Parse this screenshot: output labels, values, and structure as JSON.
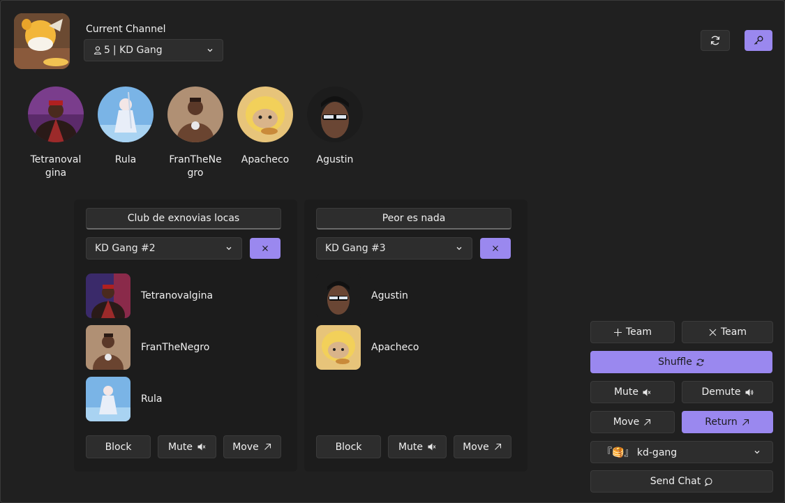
{
  "header": {
    "channel_label": "Current Channel",
    "channel_count": "5",
    "channel_name": "| KD Gang"
  },
  "members": [
    {
      "name": "Tetranovalgina"
    },
    {
      "name": "Rula"
    },
    {
      "name": "FranTheNegro"
    },
    {
      "name": "Apacheco"
    },
    {
      "name": "Agustin"
    }
  ],
  "teams": [
    {
      "name": "Club de exnovias locas",
      "channel": "KD Gang #2",
      "players": [
        "Tetranovalgina",
        "FranTheNegro",
        "Rula"
      ],
      "block_label": "Block",
      "mute_label": "Mute",
      "move_label": "Move"
    },
    {
      "name": "Peor es nada",
      "channel": "KD Gang #3",
      "players": [
        "Agustin",
        "Apacheco"
      ],
      "block_label": "Block",
      "mute_label": "Mute",
      "move_label": "Move"
    }
  ],
  "controls": {
    "add_team": "Team",
    "remove_team": "Team",
    "shuffle": "Shuffle",
    "mute": "Mute",
    "demute": "Demute",
    "move": "Move",
    "return": "Return",
    "text_channel": "『🥞』 kd-gang",
    "send_chat": "Send Chat"
  },
  "colors": {
    "background": "#202020",
    "panel": "#1c1c1c",
    "control": "#2d2d2d",
    "accent": "#9a88ef"
  }
}
